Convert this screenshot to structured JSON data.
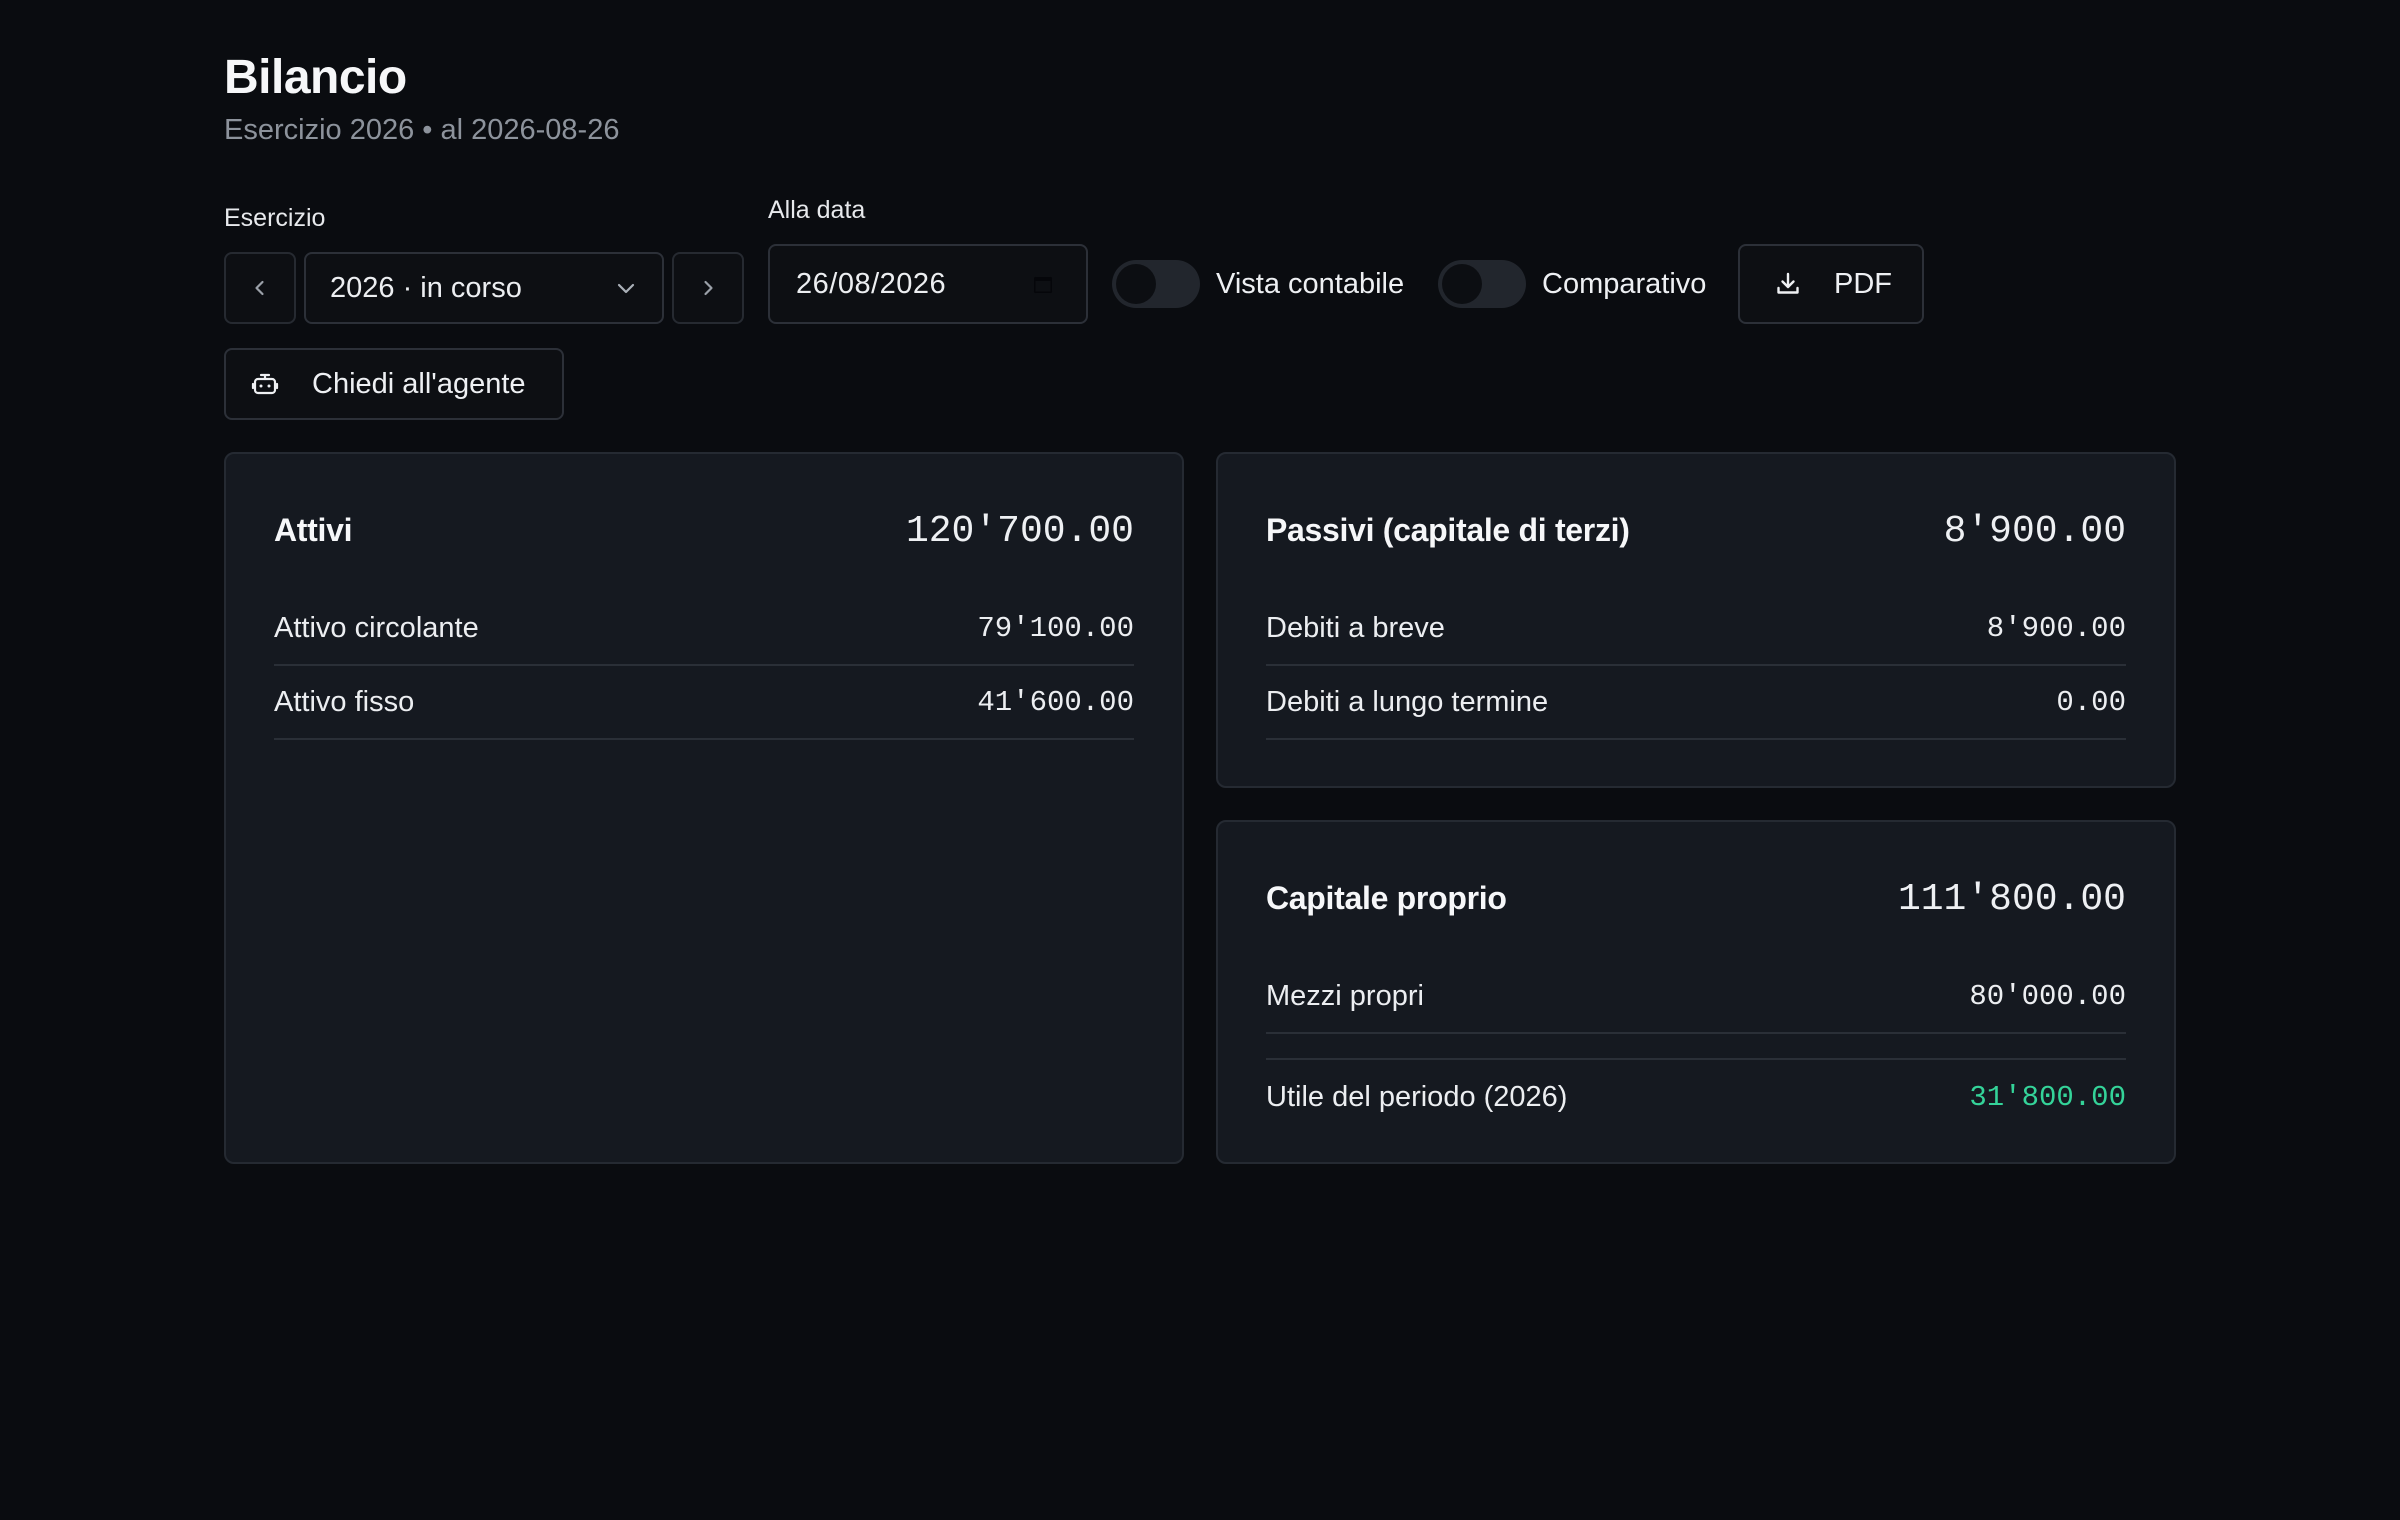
{
  "header": {
    "title": "Bilancio",
    "subtitle": "Esercizio 2026 • al 2026-08-26"
  },
  "filters": {
    "year_label": "Esercizio",
    "year_value": "2026 · in corso",
    "date_label": "Alla data",
    "date_value": "26/08/2026",
    "toggle_accounting_label": "Vista contabile",
    "toggle_accounting_on": false,
    "toggle_compare_label": "Comparativo",
    "toggle_compare_on": false,
    "pdf_label": "PDF",
    "agent_label": "Chiedi all'agente"
  },
  "assets": {
    "title": "Attivi",
    "total": "120'700.00",
    "rows": [
      {
        "label": "Attivo circolante",
        "value": "79'100.00"
      },
      {
        "label": "Attivo fisso",
        "value": "41'600.00"
      }
    ]
  },
  "liabilities": {
    "title": "Passivi (capitale di terzi)",
    "total": "8'900.00",
    "rows": [
      {
        "label": "Debiti a breve",
        "value": "8'900.00"
      },
      {
        "label": "Debiti a lungo termine",
        "value": "0.00"
      }
    ]
  },
  "equity": {
    "title": "Capitale proprio",
    "total": "111'800.00",
    "rows": [
      {
        "label": "Mezzi propri",
        "value": "80'000.00"
      }
    ],
    "profit": {
      "label": "Utile del periodo (2026)",
      "value": "31'800.00"
    }
  },
  "colors": {
    "background": "#0a0c10",
    "card": "#151920",
    "positive": "#34d399"
  },
  "icons": {
    "prev": "chevron-left-icon",
    "next": "chevron-right-icon",
    "dropdown": "chevron-down-icon",
    "calendar": "calendar-icon",
    "download": "download-icon",
    "agent": "robot-icon"
  }
}
